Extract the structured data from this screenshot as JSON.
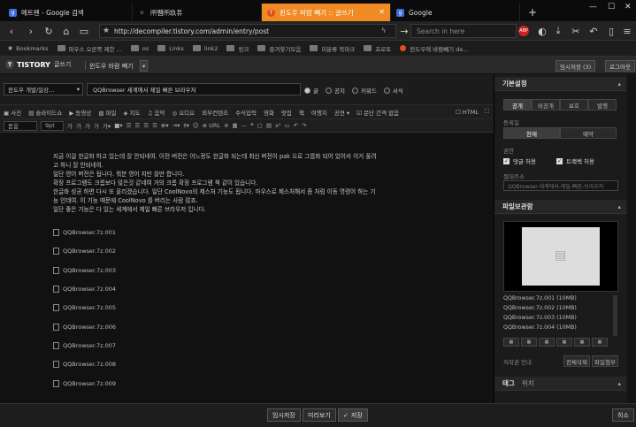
{
  "browser": {
    "tabs": [
      {
        "label": "메트펜 - Google 검색",
        "active": false,
        "favicon": "g-icon"
      },
      {
        "label": "㈜쨈㈜玖퓨",
        "active": false,
        "favicon": "star-icon"
      },
      {
        "label": "윈도우 바람 빼기 :: 글쓰기",
        "active": true,
        "favicon": "tistory-icon"
      },
      {
        "label": "Google",
        "active": false,
        "favicon": "g-icon"
      }
    ],
    "url": "http://decompiler.tistory.com/admin/entry/post",
    "search_placeholder": "Search in here",
    "bookmarks": [
      "Bookmarks",
      "마우스 오른쪽 제한 ...",
      "os",
      "Links",
      "link2",
      "링크",
      "즐겨찾기모음",
      "미분류 북마크",
      "프로토",
      "윈도우에 바람빼기 de..."
    ]
  },
  "blog_header": {
    "logo": "TISTORY",
    "write_label": "글쓰기",
    "blog_name": "윈도우 바람 빼기",
    "temp_save": "임시저장 (3)",
    "logout": "로그아웃"
  },
  "editor": {
    "category": "윈도우 개발/일상...",
    "title": "QQBrowser 세계에서 제일 빠른 브라우저",
    "visibility": [
      {
        "label": "글",
        "on": true
      },
      {
        "label": "공지",
        "on": false
      },
      {
        "label": "키워드",
        "on": false
      },
      {
        "label": "서식",
        "on": false
      }
    ],
    "attach_toolbar": [
      "사진",
      "슬라이드쇼",
      "동영상",
      "파일",
      "지도",
      "음악",
      "오디오",
      "외부컨텐츠",
      "수식입력",
      "영화",
      "맛집",
      "책",
      "여행지",
      "공연"
    ],
    "grid_label": "문단 간격 없음",
    "html_label": "HTML",
    "font": "돋움",
    "font_size": "9pt",
    "content": [
      "지금 이걸 한글화 하고 있는데 잘 안되네여. 이전 버전은 어느정도 한글화 되는데 최신 버전이 pak 으로 그룹화 되어 있어서 이거 풀려",
      "고 하니 잘 안되네여.",
      "일단 영어 버전은 됩니다. 뭐분 영어 지만 쓸만 합니다.",
      "확장 프로그램도 크롬보다 많은것 같네여 거의 크롬 확장 프로그램 책 같이 있습니다.",
      "한글화 성공 하면 다시 또 올리겠습니다. 일단 CoolNovo의 제스처 기능도 됩니다. 마우스로 제스처해서 좀 처럼 이동 명령어 하는 기",
      "능 인데여. 이 기능 때문에 CoolNovo 를 버리는 사람 많죠.",
      "일단 좋은 기능은 다 있는 세계에서 제일 빠른 브라우저 입니다."
    ],
    "files": [
      "QQBrowser.7z.001",
      "QQBrowser.7z.002",
      "QQBrowser.7z.003",
      "QQBrowser.7z.004",
      "QQBrowser.7z.005",
      "QQBrowser.7z.006",
      "QQBrowser.7z.007",
      "QQBrowser.7z.008",
      "QQBrowser.7z.009"
    ]
  },
  "right_panel": {
    "basic_title": "기본설정",
    "visibility_tabs": [
      "공개",
      "비공개",
      "보호",
      "발행"
    ],
    "register_label": "등록일",
    "register_tabs": [
      "현재",
      "예약"
    ],
    "permission_label": "권한",
    "comment_allow": "댓글 허용",
    "trackback_allow": "트랙백 허용",
    "permalink_label": "절대주소",
    "permalink_value": "QQBrowser-세계에서-제일-빠른-브라우저",
    "file_title": "파일보관함",
    "file_list": [
      "QQBrowser.7z.001 (10MB)",
      "QQBrowser.7z.002 (10MB)",
      "QQBrowser.7z.003 (10MB)",
      "QQBrowser.7z.004 (10MB)"
    ],
    "copyright_label": "저작권 안내",
    "delete_all": "전체삭제",
    "file_attach": "파일첨부",
    "tag_title": "태그",
    "location_title": "위치"
  },
  "bottom": {
    "temp_save": "임시저장",
    "preview": "미리보기",
    "save": "저장",
    "close": "히소"
  }
}
